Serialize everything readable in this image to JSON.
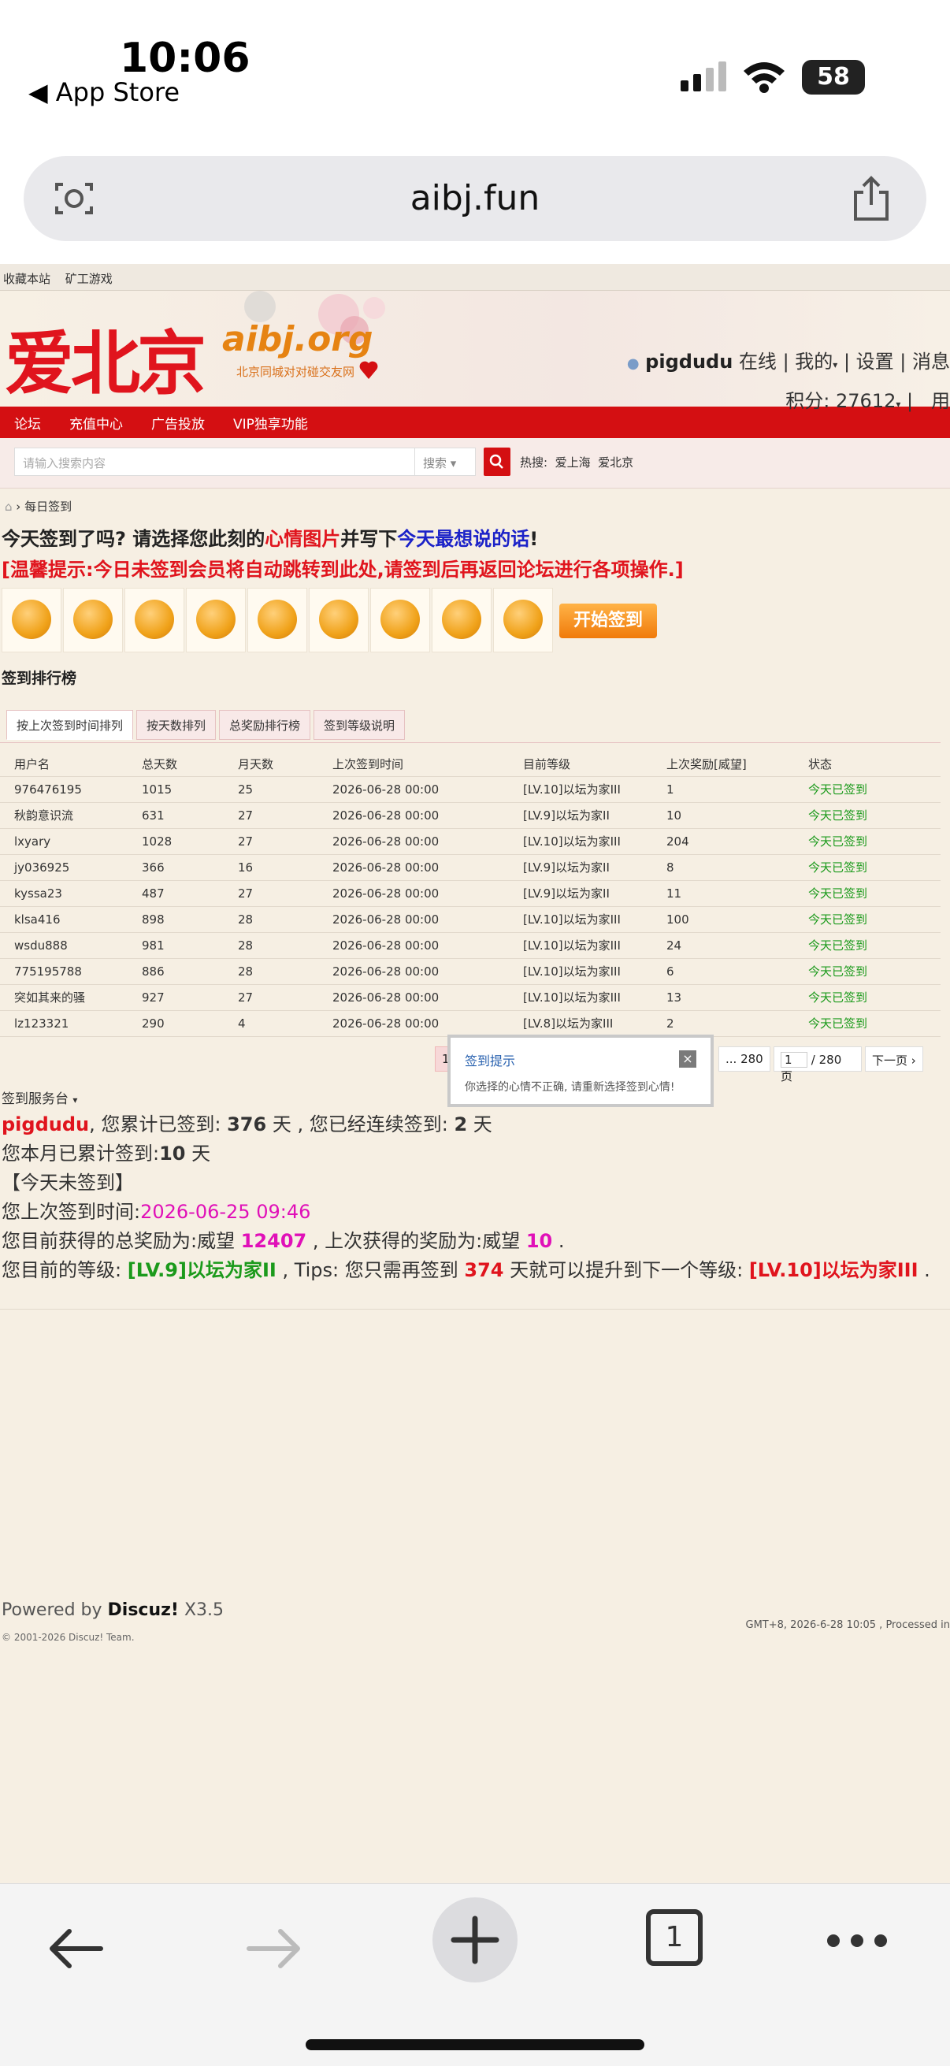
{
  "status_bar": {
    "time": "10:06",
    "back_app": "App Store",
    "battery": "58"
  },
  "browser": {
    "url": "aibj.fun"
  },
  "site": {
    "topbar": [
      "收藏本站",
      "矿工游戏"
    ],
    "logo_main": "爱北京",
    "logo_sub": "aibj.org",
    "logo_tag": "北京同城对对碰交友网",
    "user": {
      "name": "pigdudu",
      "online": "在线",
      "menu": "我的",
      "settings": "设置",
      "messages": "消息",
      "points": "积分: 27612",
      "more": "用"
    },
    "nav": [
      "论坛",
      "充值中心",
      "广告投放",
      "VIP独享功能"
    ],
    "search": {
      "placeholder": "请输入搜索内容",
      "type": "搜索",
      "hot_label": "热搜:",
      "hot_items": [
        "爱上海",
        "爱北京"
      ]
    },
    "breadcrumb": "每日签到"
  },
  "checkin": {
    "prompt_parts": [
      "今天签到了吗? 请选择您此刻的",
      "心情图片",
      "并写下",
      "今天最想说的话",
      "!"
    ],
    "warning": "[温馨提示:今日未签到会员将自动跳转到此处,请签到后再返回论坛进行各项操作.]",
    "start_button": "开始签到"
  },
  "ranking": {
    "title": "签到排行榜",
    "tabs": [
      "按上次签到时间排列",
      "按天数排列",
      "总奖励排行榜",
      "签到等级说明"
    ],
    "columns": [
      "用户名",
      "总天数",
      "月天数",
      "上次签到时间",
      "目前等级",
      "上次奖励[威望]",
      "状态"
    ],
    "rows": [
      [
        "976476195",
        "1015",
        "25",
        "2026-06-28 00:00",
        "[LV.10]以坛为家III",
        "1",
        "今天已签到"
      ],
      [
        "秋韵意识流",
        "631",
        "27",
        "2026-06-28 00:00",
        "[LV.9]以坛为家II",
        "10",
        "今天已签到"
      ],
      [
        "lxyary",
        "1028",
        "27",
        "2026-06-28 00:00",
        "[LV.10]以坛为家III",
        "204",
        "今天已签到"
      ],
      [
        "jy036925",
        "366",
        "16",
        "2026-06-28 00:00",
        "[LV.9]以坛为家II",
        "8",
        "今天已签到"
      ],
      [
        "kyssa23",
        "487",
        "27",
        "2026-06-28 00:00",
        "[LV.9]以坛为家II",
        "11",
        "今天已签到"
      ],
      [
        "klsa416",
        "898",
        "28",
        "2026-06-28 00:00",
        "[LV.10]以坛为家III",
        "100",
        "今天已签到"
      ],
      [
        "wsdu888",
        "981",
        "28",
        "2026-06-28 00:00",
        "[LV.10]以坛为家III",
        "24",
        "今天已签到"
      ],
      [
        "775195788",
        "886",
        "28",
        "2026-06-28 00:00",
        "[LV.10]以坛为家III",
        "6",
        "今天已签到"
      ],
      [
        "突如其来的骚",
        "927",
        "27",
        "2026-06-28 00:00",
        "[LV.10]以坛为家III",
        "13",
        "今天已签到"
      ],
      [
        "lz123321",
        "290",
        "4",
        "2026-06-28 00:00",
        "[LV.8]以坛为家III",
        "2",
        "今天已签到"
      ]
    ],
    "pager": {
      "current": "1",
      "last": "... 280",
      "input": "1",
      "total": "/ 280 页",
      "next": "下一页"
    }
  },
  "popup": {
    "title": "签到提示",
    "message": "你选择的心情不正确, 请重新选择签到心情!",
    "close": "×"
  },
  "service": {
    "title": "签到服务台",
    "username": "pigdudu",
    "line1_a": ", 您累计已签到: ",
    "total_days": "376",
    "line1_b": " 天 , 您已经连续签到: ",
    "streak": "2",
    "line1_c": " 天",
    "line2_a": "您本月已累计签到:",
    "month_days": "10",
    "line2_b": " 天",
    "line3": "【今天未签到】",
    "line4_a": "您上次签到时间:",
    "last_time": "2026-06-25 09:46",
    "line5_a": "您目前获得的总奖励为:威望 ",
    "total_reward": "12407",
    "line5_b": " , 上次获得的奖励为:威望 ",
    "last_reward": "10",
    "line5_c": " .",
    "line6_a": "您目前的等级: ",
    "cur_level": "[LV.9]以坛为家II",
    "line6_b": " , Tips: 您只需再签到 ",
    "need_days": "374",
    "line6_c": " 天就可以提升到下一个等级: ",
    "next_level": "[LV.10]以坛为家III",
    "line6_d": " ."
  },
  "footer": {
    "powered_a": "Powered by ",
    "powered_b": "Discuz!",
    "powered_c": " X3.5",
    "copyright": "© 2001-2026 Discuz! Team.",
    "gmt": "GMT+8, 2026-6-28 10:05 , Processed in"
  },
  "toolbar": {
    "tabs_count": "1"
  }
}
